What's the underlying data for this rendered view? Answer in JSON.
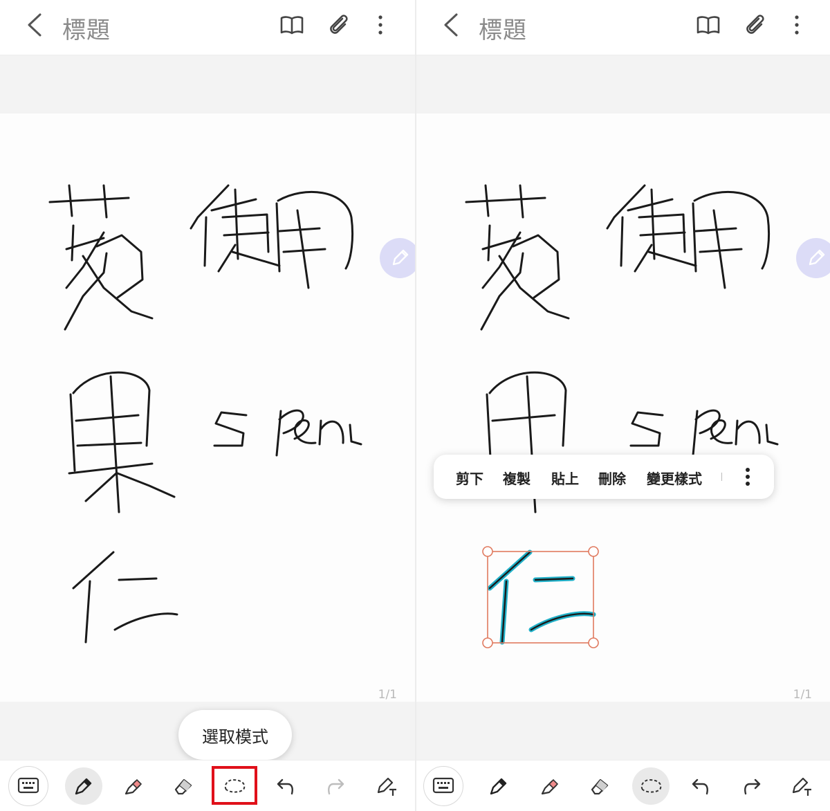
{
  "left": {
    "header": {
      "title": "標題"
    },
    "page_indicator": "1/1",
    "tooltip": "選取模式",
    "ink_icon": "pen-float-icon"
  },
  "right": {
    "header": {
      "title": "標題"
    },
    "page_indicator": "1/1",
    "context_menu": {
      "items": [
        "剪下",
        "複製",
        "貼上",
        "刪除",
        "變更樣式"
      ]
    }
  },
  "handwriting": [
    "蘋",
    "使用",
    "果",
    "S Pen",
    "仁"
  ],
  "toolbar": {
    "tools": [
      "keyboard-icon",
      "pen-icon",
      "highlighter-icon",
      "eraser-icon",
      "lasso-select-icon",
      "undo-icon",
      "redo-icon",
      "pen-text-icon"
    ]
  },
  "colors": {
    "highlight": "#e0101a",
    "selection": "#e07a5f",
    "selected_ink": "#20b0c8",
    "fab": "#dcdcf7",
    "highlighter": "#f08b8b"
  }
}
